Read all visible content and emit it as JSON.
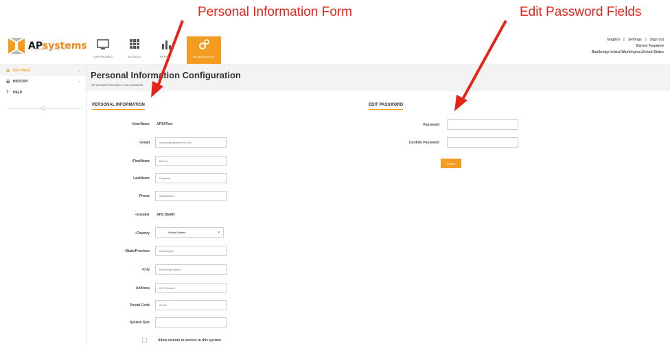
{
  "annotations": {
    "personal_form": "Personal Information Form",
    "edit_password": "Edit Password Fields"
  },
  "brand": {
    "logo_prefix": "AP",
    "logo_suffix": "systems",
    "tagline": "ALTENERGY POWER",
    "accent_color": "#f49c22"
  },
  "nav": {
    "items": [
      {
        "label": "DASHBOARD",
        "icon": "monitor-icon"
      },
      {
        "label": "MODULE",
        "icon": "grid-icon"
      },
      {
        "label": "REPORT",
        "icon": "bar-chart-icon"
      },
      {
        "label": "MANAGEMENT",
        "icon": "gears-icon"
      }
    ]
  },
  "topright": {
    "language": "English",
    "settings": "Settings",
    "signout": "Sign out",
    "user_name": "Barney Farpatsw",
    "location": "Bainbridge Island,Washington,United States"
  },
  "sidebar": {
    "items": [
      {
        "label": "SETTINGS",
        "icon": "gear-icon"
      },
      {
        "label": "HISTORY",
        "icon": "list-icon"
      },
      {
        "label": "HELP",
        "icon": "question-icon"
      }
    ]
  },
  "main": {
    "title": "Personal Information Configuration",
    "subtitle": "Set personal information or your password"
  },
  "personal": {
    "section_title": "PERSONAL INFORMATION",
    "username_label": "UserName",
    "username_value": "APSATest",
    "email_label": "Email",
    "email_value": "support@apsamerica.com",
    "firstname_label": "FirstName",
    "firstname_value": "Barney",
    "lastname_label": "LastName",
    "lastname_value": "Farpatsw",
    "phone_label": "Phone",
    "phone_value": "2065550261",
    "installer_label": "Installer",
    "installer_value": "APS DEMO",
    "country_label": "Country",
    "country_value": "United States",
    "state_label": "State/Province",
    "state_value": "Washington",
    "city_label": "City",
    "city_value": "Bainbridge Island",
    "address_label": "Address",
    "address_value": "600 Ericksen",
    "postal_label": "Postal Code",
    "postal_value": "98110",
    "system_size_label": "System Size",
    "system_size_value": "",
    "allow_visitors_label": "Allow visitors to access to this system"
  },
  "password": {
    "section_title": "EDIT PASSWORD",
    "password_label": "Password",
    "confirm_label": "Confirm Password",
    "submit_label": "Submit"
  }
}
